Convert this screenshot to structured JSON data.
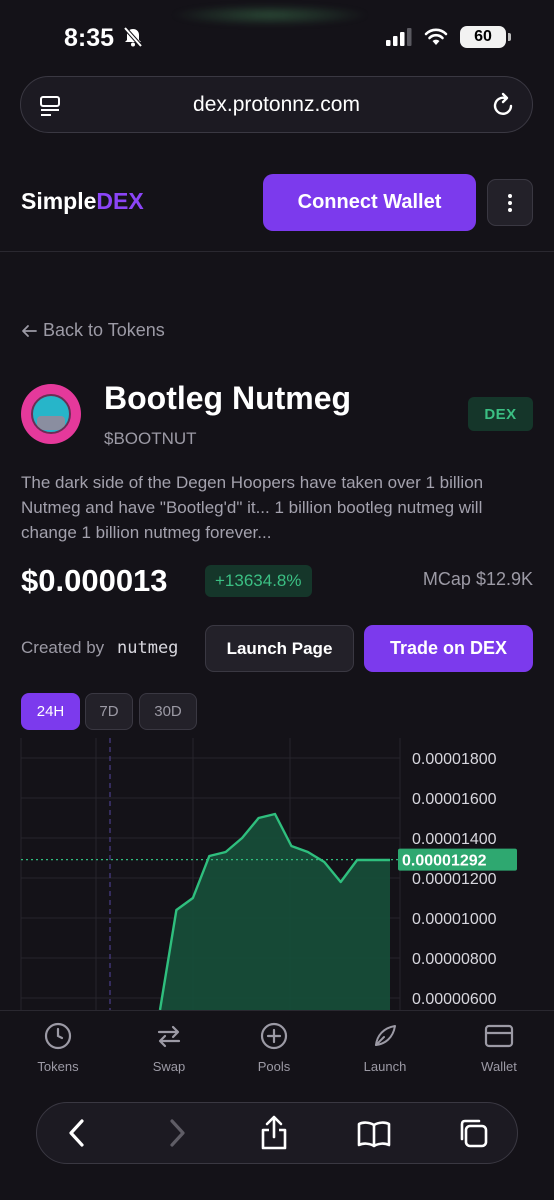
{
  "status_bar": {
    "time": "8:35",
    "battery": "60"
  },
  "browser": {
    "url": "dex.protonnz.com"
  },
  "header": {
    "logo_part1": "Simple",
    "logo_part2": "DEX",
    "connect_label": "Connect Wallet"
  },
  "back_label": "Back to Tokens",
  "token": {
    "name": "Bootleg Nutmeg",
    "symbol": "$BOOTNUT",
    "badge": "DEX",
    "description": "The dark side of the Degen Hoopers have taken over 1 billion Nutmeg and have \"Bootleg'd\" it... 1 billion bootleg nutmeg will change 1 billion nutmeg forever...",
    "price": "$0.000013",
    "change": "+13634.8%",
    "mcap": "MCap $12.9K",
    "created_by_label": "Created by",
    "creator": "nutmeg",
    "launch_page_label": "Launch Page",
    "trade_label": "Trade on DEX"
  },
  "ranges": [
    {
      "label": "24H",
      "active": true
    },
    {
      "label": "7D",
      "active": false
    },
    {
      "label": "30D",
      "active": false
    }
  ],
  "chart_data": {
    "type": "area",
    "y_ticks": [
      "0.00001800",
      "0.00001600",
      "0.00001400",
      "0.00001200",
      "0.00001000",
      "0.00000800",
      "0.00000600"
    ],
    "ylim": [
      5.4e-06,
      1.9e-05
    ],
    "current_value_label": "0.00001292",
    "current_value": 1.292e-05,
    "values": [
      5.4e-06,
      1.04e-05,
      1.1e-05,
      1.31e-05,
      1.33e-05,
      1.4e-05,
      1.5e-05,
      1.52e-05,
      1.36e-05,
      1.33e-05,
      1.28e-05,
      1.18e-05,
      1.29e-05,
      1.29e-05,
      1.29e-05
    ],
    "colors": {
      "line": "#2fbf7e",
      "fill": "#16503a",
      "current": "#2fbf7e"
    }
  },
  "bottom_nav": [
    {
      "label": "Tokens",
      "icon": "clock-icon"
    },
    {
      "label": "Swap",
      "icon": "swap-icon"
    },
    {
      "label": "Pools",
      "icon": "plus-circle-icon"
    },
    {
      "label": "Launch",
      "icon": "rocket-icon"
    },
    {
      "label": "Wallet",
      "icon": "wallet-icon"
    }
  ],
  "colors": {
    "accent": "#7C3AED",
    "positive": "#3bbf83",
    "background": "#141218"
  }
}
